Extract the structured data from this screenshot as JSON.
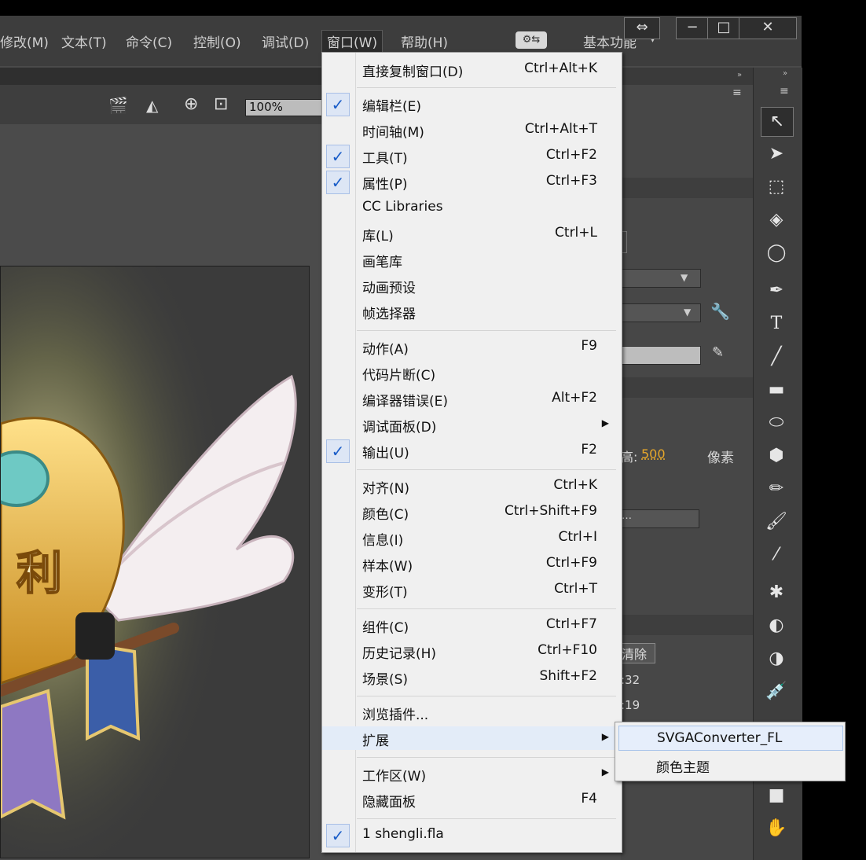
{
  "menubar": {
    "items": [
      "修改(M)",
      "文本(T)",
      "命令(C)",
      "控制(O)",
      "调试(D)",
      "窗口(W)",
      "帮助(H)"
    ],
    "workspace": "基本功能",
    "window_controls": {
      "minimize": "−",
      "maximize": "□",
      "close": "✕"
    }
  },
  "doc_toolbar": {
    "zoom": "100%"
  },
  "properties": {
    "height_label": "高:",
    "height_value": "500",
    "unit": "像素",
    "clear_button": "清除",
    "time1": ":32",
    "time2": ":19"
  },
  "window_menu": [
    {
      "label": "直接复制窗口(D)",
      "shortcut": "Ctrl+Alt+K",
      "checked": false
    },
    {
      "label": "编辑栏(E)",
      "shortcut": "",
      "checked": true
    },
    {
      "label": "时间轴(M)",
      "shortcut": "Ctrl+Alt+T",
      "checked": false
    },
    {
      "label": "工具(T)",
      "shortcut": "Ctrl+F2",
      "checked": true
    },
    {
      "label": "属性(P)",
      "shortcut": "Ctrl+F3",
      "checked": true
    },
    {
      "label": "CC Libraries",
      "shortcut": "",
      "checked": false
    },
    {
      "label": "库(L)",
      "shortcut": "Ctrl+L",
      "checked": false
    },
    {
      "label": "画笔库",
      "shortcut": "",
      "checked": false
    },
    {
      "label": "动画预设",
      "shortcut": "",
      "checked": false
    },
    {
      "label": "帧选择器",
      "shortcut": "",
      "checked": false
    },
    {
      "label": "动作(A)",
      "shortcut": "F9",
      "checked": false
    },
    {
      "label": "代码片断(C)",
      "shortcut": "",
      "checked": false
    },
    {
      "label": "编译器错误(E)",
      "shortcut": "Alt+F2",
      "checked": false
    },
    {
      "label": "调试面板(D)",
      "shortcut": "",
      "checked": false,
      "submenu": true
    },
    {
      "label": "输出(U)",
      "shortcut": "F2",
      "checked": true
    },
    {
      "label": "对齐(N)",
      "shortcut": "Ctrl+K",
      "checked": false
    },
    {
      "label": "颜色(C)",
      "shortcut": "Ctrl+Shift+F9",
      "checked": false
    },
    {
      "label": "信息(I)",
      "shortcut": "Ctrl+I",
      "checked": false
    },
    {
      "label": "样本(W)",
      "shortcut": "Ctrl+F9",
      "checked": false
    },
    {
      "label": "变形(T)",
      "shortcut": "Ctrl+T",
      "checked": false
    },
    {
      "label": "组件(C)",
      "shortcut": "Ctrl+F7",
      "checked": false
    },
    {
      "label": "历史记录(H)",
      "shortcut": "Ctrl+F10",
      "checked": false
    },
    {
      "label": "场景(S)",
      "shortcut": "Shift+F2",
      "checked": false
    },
    {
      "label": "浏览插件...",
      "shortcut": "",
      "checked": false
    },
    {
      "label": "扩展",
      "shortcut": "",
      "checked": false,
      "submenu": true,
      "highlighted": true
    },
    {
      "label": "工作区(W)",
      "shortcut": "",
      "checked": false,
      "submenu": true
    },
    {
      "label": "隐藏面板",
      "shortcut": "F4",
      "checked": false
    },
    {
      "label": "1 shengli.fla",
      "shortcut": "",
      "checked": true
    }
  ],
  "extensions_submenu": [
    "SVGAConverter_FL",
    "颜色主题"
  ],
  "colors": {
    "menu_bg": "#f0f0f0",
    "check": "#1a5dc8",
    "highlight": "#e3ecf8",
    "app_bg": "#4a4a4a"
  }
}
